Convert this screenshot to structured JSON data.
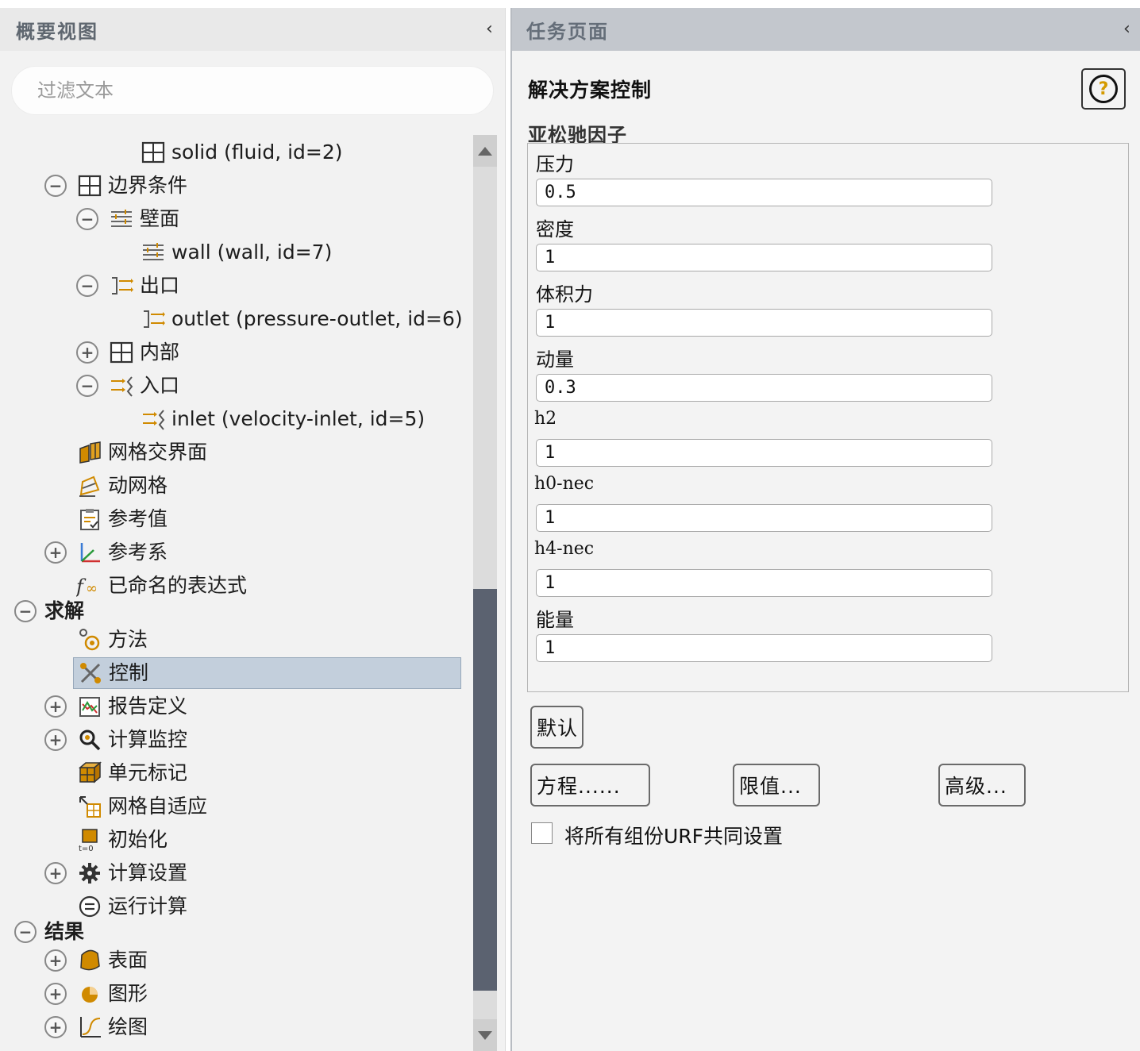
{
  "left_panel": {
    "title": "概要视图",
    "collapse": "‹",
    "filter_placeholder": "过滤文本",
    "tree": [
      {
        "label": "solid (fluid, id=2)",
        "icon": "grid-icon"
      },
      {
        "label": "边界条件",
        "icon": "grid-icon",
        "expander": "−"
      },
      {
        "label": "壁面",
        "icon": "wall-icon",
        "expander": "−"
      },
      {
        "label": "wall (wall, id=7)",
        "icon": "wall-icon"
      },
      {
        "label": "出口",
        "icon": "outlet-icon",
        "expander": "−"
      },
      {
        "label": "outlet (pressure-outlet, id=6)",
        "icon": "outlet-icon"
      },
      {
        "label": "内部",
        "icon": "grid-icon",
        "expander": "+"
      },
      {
        "label": "入口",
        "icon": "inlet-icon",
        "expander": "−"
      },
      {
        "label": "inlet (velocity-inlet, id=5)",
        "icon": "inlet-icon"
      },
      {
        "label": "网格交界面",
        "icon": "mesh-interface-icon"
      },
      {
        "label": "动网格",
        "icon": "dynamic-mesh-icon"
      },
      {
        "label": "参考值",
        "icon": "reference-values-icon"
      },
      {
        "label": "参考系",
        "icon": "reference-frame-icon",
        "expander": "+"
      },
      {
        "label": "已命名的表达式",
        "icon": "function-icon"
      },
      {
        "label": "求解",
        "expander": "−"
      },
      {
        "label": "方法",
        "icon": "methods-icon"
      },
      {
        "label": "控制",
        "icon": "controls-icon",
        "selected": true
      },
      {
        "label": "报告定义",
        "icon": "report-icon",
        "expander": "+"
      },
      {
        "label": "计算监控",
        "icon": "monitor-icon",
        "expander": "+"
      },
      {
        "label": "单元标记",
        "icon": "cell-register-icon"
      },
      {
        "label": "网格自适应",
        "icon": "mesh-adapt-icon"
      },
      {
        "label": "初始化",
        "icon": "initialization-icon"
      },
      {
        "label": "计算设置",
        "icon": "calc-settings-icon",
        "expander": "+"
      },
      {
        "label": "运行计算",
        "icon": "run-calc-icon"
      },
      {
        "label": "结果",
        "expander": "−"
      },
      {
        "label": "表面",
        "icon": "surface-icon",
        "expander": "+"
      },
      {
        "label": "图形",
        "icon": "graphics-icon",
        "expander": "+"
      },
      {
        "label": "绘图",
        "icon": "plot-icon",
        "expander": "+"
      }
    ]
  },
  "right_panel": {
    "title": "任务页面",
    "collapse": "‹",
    "section_title": "解决方案控制",
    "help": "?",
    "group_title": "亚松驰因子",
    "fields": [
      {
        "label": "压力",
        "value": "0.5"
      },
      {
        "label": "密度",
        "value": "1"
      },
      {
        "label": "体积力",
        "value": "1"
      },
      {
        "label": "动量",
        "value": "0.3"
      },
      {
        "label": "h2",
        "value": "1"
      },
      {
        "label": "h0-nec",
        "value": "1"
      },
      {
        "label": "h4-nec",
        "value": "1"
      },
      {
        "label": "能量",
        "value": "1"
      }
    ],
    "buttons": {
      "default": "默认",
      "equations": "方程......",
      "limits": "限值...",
      "advanced": "高级..."
    },
    "checkbox_label": "将所有组份URF共同设置",
    "checkbox_checked": false
  },
  "colors": {
    "selected_row": "#c3cfdc",
    "right_header": "#c3c7cd",
    "scroll_thumb": "#5b6270"
  }
}
